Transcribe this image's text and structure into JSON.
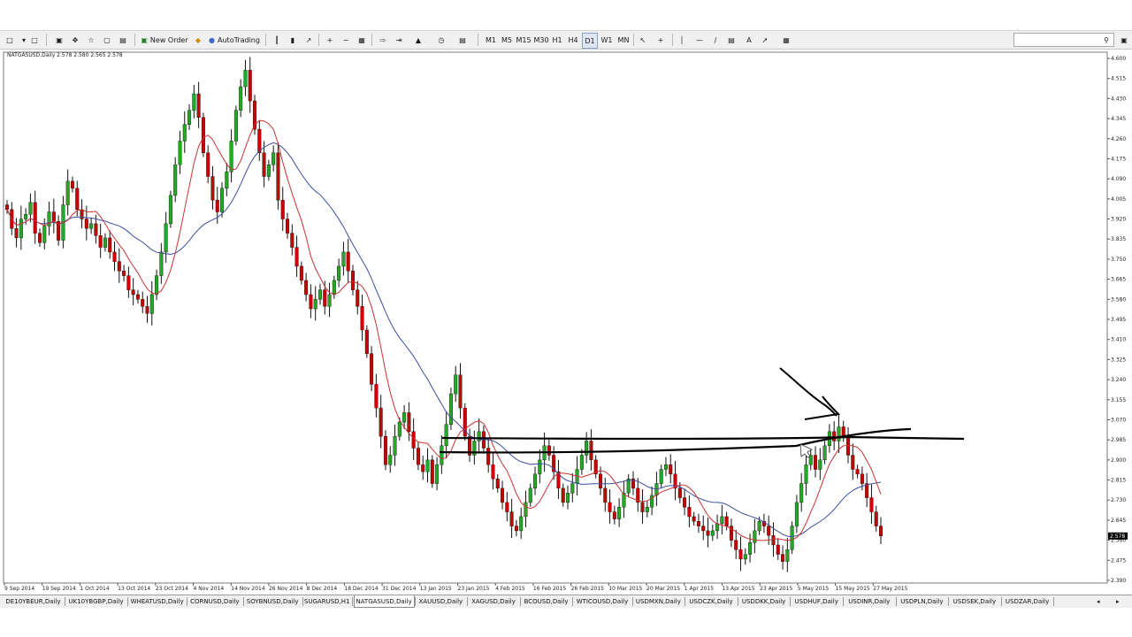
{
  "toolbar": {
    "new_order": "New Order",
    "autotrading": "AutoTrading",
    "timeframes": [
      "M1",
      "M5",
      "M15",
      "M30",
      "H1",
      "H4",
      "D1",
      "W1",
      "MN"
    ],
    "active_timeframe": "D1",
    "search_icon": "magnifier-icon"
  },
  "chart": {
    "header": "NATGASUSD,Daily  2.578 2.580 2.565 2.578",
    "price_labels": [
      "4.600",
      "4.515",
      "4.430",
      "4.345",
      "4.260",
      "4.175",
      "4.090",
      "4.005",
      "3.920",
      "3.835",
      "3.750",
      "3.665",
      "3.580",
      "3.495",
      "3.410",
      "3.325",
      "3.240",
      "3.155",
      "3.070",
      "2.985",
      "2.900",
      "2.815",
      "2.730",
      "2.645",
      "2.560",
      "2.475",
      "2.390"
    ],
    "current_price": "2.578",
    "date_labels": [
      "9 Sep 2014",
      "19 Sep 2014",
      "1 Oct 2014",
      "13 Oct 2014",
      "23 Oct 2014",
      "4 Nov 2014",
      "14 Nov 2014",
      "26 Nov 2014",
      "8 Dec 2014",
      "18 Dec 2014",
      "31 Dec 2014",
      "13 Jan 2015",
      "23 Jan 2015",
      "4 Feb 2015",
      "16 Feb 2015",
      "26 Feb 2015",
      "10 Mar 2015",
      "20 Mar 2015",
      "1 Apr 2015",
      "13 Apr 2015",
      "23 Apr 2015",
      "5 May 2015",
      "15 May 2015",
      "27 May 2015"
    ],
    "colors": {
      "bull": "#22aa22",
      "bear": "#cc0000",
      "ma_fast": "#c83232",
      "ma_slow": "#3c4ea0",
      "drawing": "#000000"
    }
  },
  "chart_data": {
    "type": "candlestick",
    "symbol": "NATGASUSD",
    "timeframe": "Daily",
    "ylim": [
      2.39,
      4.6
    ],
    "closes": [
      3.96,
      3.88,
      3.84,
      3.92,
      3.94,
      3.99,
      3.86,
      3.82,
      3.89,
      3.95,
      3.91,
      3.83,
      3.98,
      4.08,
      4.05,
      3.96,
      3.92,
      3.88,
      3.9,
      3.85,
      3.8,
      3.84,
      3.78,
      3.74,
      3.7,
      3.68,
      3.62,
      3.6,
      3.58,
      3.55,
      3.52,
      3.6,
      3.68,
      3.78,
      3.9,
      4.02,
      4.15,
      4.25,
      4.32,
      4.38,
      4.45,
      4.35,
      4.2,
      4.1,
      4.0,
      3.95,
      4.05,
      4.12,
      4.25,
      4.38,
      4.48,
      4.55,
      4.42,
      4.3,
      4.2,
      4.1,
      4.15,
      4.2,
      4.0,
      3.92,
      3.86,
      3.8,
      3.72,
      3.66,
      3.6,
      3.54,
      3.58,
      3.62,
      3.55,
      3.6,
      3.66,
      3.72,
      3.78,
      3.7,
      3.62,
      3.55,
      3.45,
      3.35,
      3.22,
      3.12,
      3.0,
      2.88,
      2.92,
      3.0,
      3.06,
      3.1,
      3.02,
      2.95,
      2.88,
      2.85,
      2.9,
      2.8,
      2.88,
      2.96,
      3.05,
      3.18,
      3.26,
      3.12,
      3.0,
      2.92,
      2.98,
      3.02,
      2.95,
      2.88,
      2.82,
      2.78,
      2.72,
      2.68,
      2.62,
      2.6,
      2.66,
      2.72,
      2.78,
      2.84,
      2.9,
      2.96,
      2.92,
      2.85,
      2.78,
      2.72,
      2.76,
      2.8,
      2.86,
      2.92,
      2.98,
      2.9,
      2.84,
      2.78,
      2.72,
      2.68,
      2.65,
      2.7,
      2.76,
      2.82,
      2.78,
      2.72,
      2.68,
      2.7,
      2.75,
      2.8,
      2.86,
      2.88,
      2.84,
      2.78,
      2.74,
      2.7,
      2.66,
      2.64,
      2.62,
      2.6,
      2.58,
      2.6,
      2.63,
      2.66,
      2.62,
      2.56,
      2.52,
      2.48,
      2.5,
      2.55,
      2.6,
      2.64,
      2.62,
      2.58,
      2.54,
      2.5,
      2.47,
      2.52,
      2.62,
      2.72,
      2.8,
      2.88,
      2.92,
      2.86,
      2.9,
      2.96,
      3.02,
      2.98,
      3.04,
      3.0,
      2.92,
      2.86,
      2.84,
      2.8,
      2.74,
      2.68,
      2.62,
      2.578
    ],
    "series": [
      {
        "name": "MA fast"
      },
      {
        "name": "MA slow"
      }
    ],
    "annotations": [
      "resistance-line",
      "resistance-line",
      "arrow"
    ]
  },
  "tabs": [
    "DE10YBEUR,Daily",
    "UK10YBGBP,Daily",
    "WHEATUSD,Daily",
    "CORNUSD,Daily",
    "SOYBNUSD,Daily",
    "SUGARUSD,H1",
    "NATGASUSD,Daily",
    "XAUUSD,Daily",
    "XAGUSD,Daily",
    "BCOUSD,Daily",
    "WTICOUSD,Daily",
    "USDMXN,Daily",
    "USDCZK,Daily",
    "USDDKK,Daily",
    "USDHUF,Daily",
    "USDINR,Daily",
    "USDPLN,Daily",
    "USDSEK,Daily",
    "USDZAR,Daily"
  ],
  "active_tab": "NATGASUSD,Daily"
}
